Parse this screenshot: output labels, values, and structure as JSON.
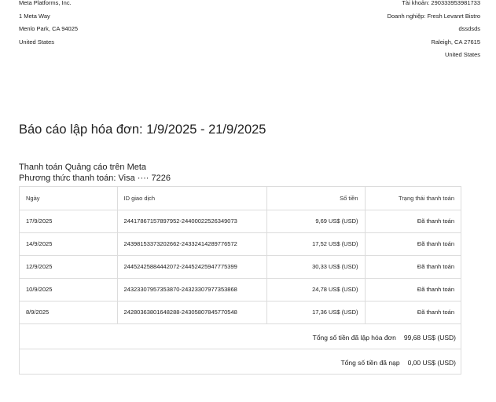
{
  "seller": {
    "name": "Meta Platforms, Inc.",
    "street": "1 Meta Way",
    "city": "Menlo Park, CA 94025",
    "country": "United States"
  },
  "account": {
    "account_line": "Tài khoản: 290333953981733",
    "business_line": "Doanh nghiệp: Fresh Levanrt Bistro",
    "street": "dssdsds",
    "city": "Raleigh, CA 27615",
    "country": "United States"
  },
  "report": {
    "title": "Báo cáo lập hóa đơn: 1/9/2025 - 21/9/2025",
    "subtitle": "Thanh toán Quảng cáo trên Meta",
    "payment_method": "Phương thức thanh toán: Visa ···· 7226"
  },
  "table": {
    "headers": [
      "Ngày",
      "ID giao dịch",
      "Số tiền",
      "Trạng thái thanh toán"
    ],
    "rows": [
      {
        "date": "17/9/2025",
        "id": "24417867157897952-24400022526349073",
        "amount": "9,69 US$ (USD)",
        "status": "Đã thanh toán"
      },
      {
        "date": "14/9/2025",
        "id": "24398153373202662-24332414289776572",
        "amount": "17,52 US$ (USD)",
        "status": "Đã thanh toán"
      },
      {
        "date": "12/9/2025",
        "id": "24452425884442072-24452425947775399",
        "amount": "30,33 US$ (USD)",
        "status": "Đã thanh toán"
      },
      {
        "date": "10/9/2025",
        "id": "24323307957353870-24323307977353868",
        "amount": "24,78 US$ (USD)",
        "status": "Đã thanh toán"
      },
      {
        "date": "8/9/2025",
        "id": "24280363801648288-24305807845770548",
        "amount": "17,36 US$ (USD)",
        "status": "Đã thanh toán"
      }
    ]
  },
  "totals": {
    "billed_label": "Tổng số tiền đã lập hóa đơn",
    "billed_value": "99,68 US$ (USD)",
    "paid_label": "Tổng số tiền đã nạp",
    "paid_value": "0,00 US$ (USD)"
  }
}
